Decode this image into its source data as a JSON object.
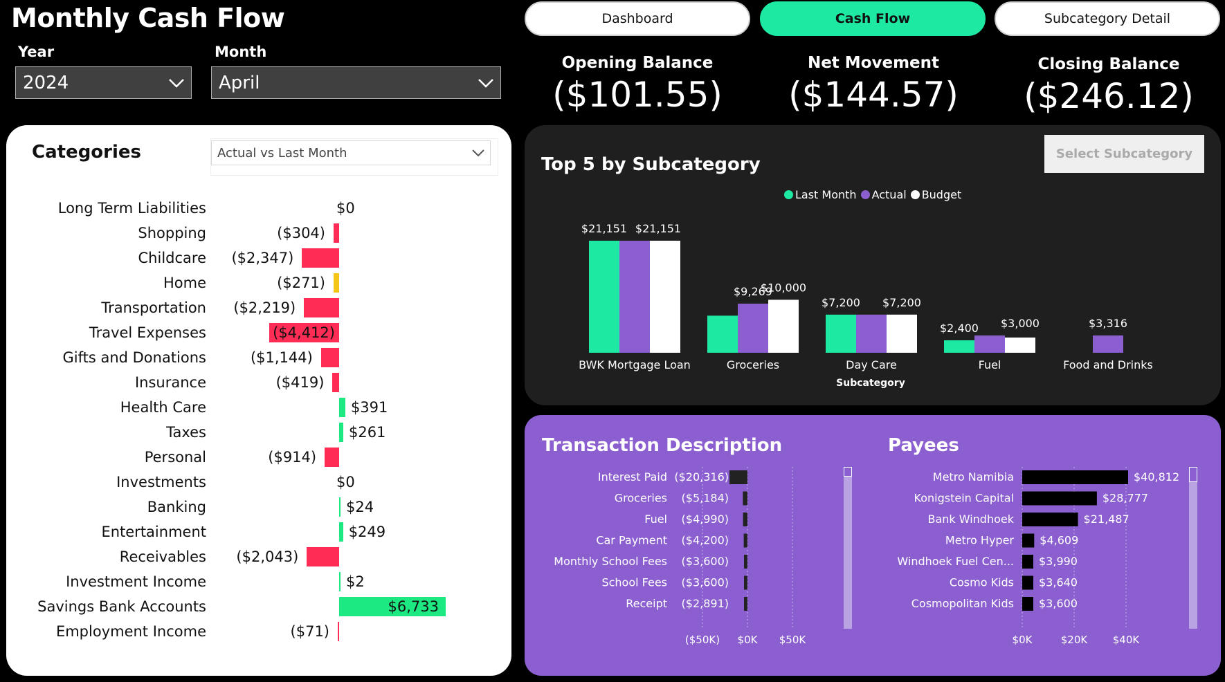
{
  "header": {
    "title": "Monthly Cash Flow",
    "year_label": "Year",
    "year_value": "2024",
    "month_label": "Month",
    "month_value": "April"
  },
  "nav": {
    "tabs": [
      {
        "label": "Dashboard",
        "active": false
      },
      {
        "label": "Cash Flow",
        "active": true
      },
      {
        "label": "Subcategory Detail",
        "active": false
      }
    ]
  },
  "kpis": [
    {
      "label": "Opening Balance",
      "value": "($101.55)"
    },
    {
      "label": "Net Movement",
      "value": "($144.57)"
    },
    {
      "label": "Closing Balance",
      "value": "($246.12)"
    }
  ],
  "categories": {
    "title": "Categories",
    "view_select": "Actual vs Last Month",
    "rows": [
      {
        "name": "Long Term Liabilities",
        "value": 0,
        "label": "$0",
        "color": "#ff2d55"
      },
      {
        "name": "Shopping",
        "value": -304,
        "label": "($304)",
        "color": "#ff2d55"
      },
      {
        "name": "Childcare",
        "value": -2347,
        "label": "($2,347)",
        "color": "#ff2d55"
      },
      {
        "name": "Home",
        "value": -271,
        "label": "($271)",
        "color": "#f5c518"
      },
      {
        "name": "Transportation",
        "value": -2219,
        "label": "($2,219)",
        "color": "#ff2d55"
      },
      {
        "name": "Travel Expenses",
        "value": -4412,
        "label": "($4,412)",
        "color": "#ff2d55"
      },
      {
        "name": "Gifts and Donations",
        "value": -1144,
        "label": "($1,144)",
        "color": "#ff2d55"
      },
      {
        "name": "Insurance",
        "value": -419,
        "label": "($419)",
        "color": "#ff2d55"
      },
      {
        "name": "Health Care",
        "value": 391,
        "label": "$391",
        "color": "#1de982"
      },
      {
        "name": "Taxes",
        "value": 261,
        "label": "$261",
        "color": "#1de982"
      },
      {
        "name": "Personal",
        "value": -914,
        "label": "($914)",
        "color": "#ff2d55"
      },
      {
        "name": "Investments",
        "value": 0,
        "label": "$0",
        "color": "#1de982"
      },
      {
        "name": "Banking",
        "value": 24,
        "label": "$24",
        "color": "#1de982"
      },
      {
        "name": "Entertainment",
        "value": 249,
        "label": "$249",
        "color": "#1de982"
      },
      {
        "name": "Receivables",
        "value": -2043,
        "label": "($2,043)",
        "color": "#ff2d55"
      },
      {
        "name": "Investment Income",
        "value": 2,
        "label": "$2",
        "color": "#1de982"
      },
      {
        "name": "Savings Bank Accounts",
        "value": 6733,
        "label": "$6,733",
        "color": "#1de982"
      },
      {
        "name": "Employment Income",
        "value": -71,
        "label": "($71)",
        "color": "#ff2d55"
      }
    ]
  },
  "top5": {
    "title": "Top 5 by Subcategory",
    "select_button": "Select Subcategory",
    "xlabel": "Subcategory"
  },
  "chart_data": [
    {
      "type": "bar",
      "title": "Top 5 by Subcategory",
      "xlabel": "Subcategory",
      "categories": [
        "BWK Mortgage Loan",
        "Groceries",
        "Day Care",
        "Fuel",
        "Food and Drinks"
      ],
      "series": [
        {
          "name": "Last Month",
          "color": "#1de9a2",
          "values": [
            21151,
            7000,
            7200,
            2400,
            0
          ],
          "labels": [
            "$21,151",
            "",
            "$7,200",
            "$2,400",
            ""
          ]
        },
        {
          "name": "Actual",
          "color": "#8b5fcf",
          "values": [
            21151,
            9269,
            7200,
            3316,
            3316
          ],
          "labels": [
            "",
            "$9,269",
            "",
            "",
            "$3,316"
          ]
        },
        {
          "name": "Budget",
          "color": "#ffffff",
          "values": [
            21151,
            10000,
            7200,
            3000,
            0
          ],
          "labels": [
            "$21,151",
            "$10,000",
            "$7,200",
            "$3,000",
            ""
          ]
        }
      ]
    },
    {
      "type": "bar",
      "title": "Transaction Description",
      "categories": [
        "Interest Paid",
        "Groceries",
        "Fuel",
        "Car Payment",
        "Monthly School Fees",
        "School Fees",
        "Receipt"
      ],
      "values": [
        -20316,
        -5184,
        -4990,
        -4200,
        -3600,
        -3600,
        -2891
      ],
      "labels": [
        "($20,316)",
        "($5,184)",
        "($4,990)",
        "($4,200)",
        "($3,600)",
        "($3,600)",
        "($2,891)"
      ],
      "xticks": [
        "($50K)",
        "$0K",
        "$50K"
      ],
      "xlim": [
        -50000,
        50000
      ]
    },
    {
      "type": "bar",
      "title": "Payees",
      "categories": [
        "Metro Namibia",
        "Konigstein Capital",
        "Bank Windhoek",
        "Metro Hyper",
        "Windhoek Fuel Cen...",
        "Cosmo Kids",
        "Cosmopolitan Kids"
      ],
      "values": [
        40812,
        28777,
        21487,
        4609,
        3990,
        3640,
        3600
      ],
      "labels": [
        "$40,812",
        "$28,777",
        "$21,487",
        "$4,609",
        "$3,990",
        "$3,640",
        "$3,600"
      ],
      "xticks": [
        "$0K",
        "$20K",
        "$40K"
      ],
      "xlim": [
        0,
        50000
      ]
    }
  ]
}
